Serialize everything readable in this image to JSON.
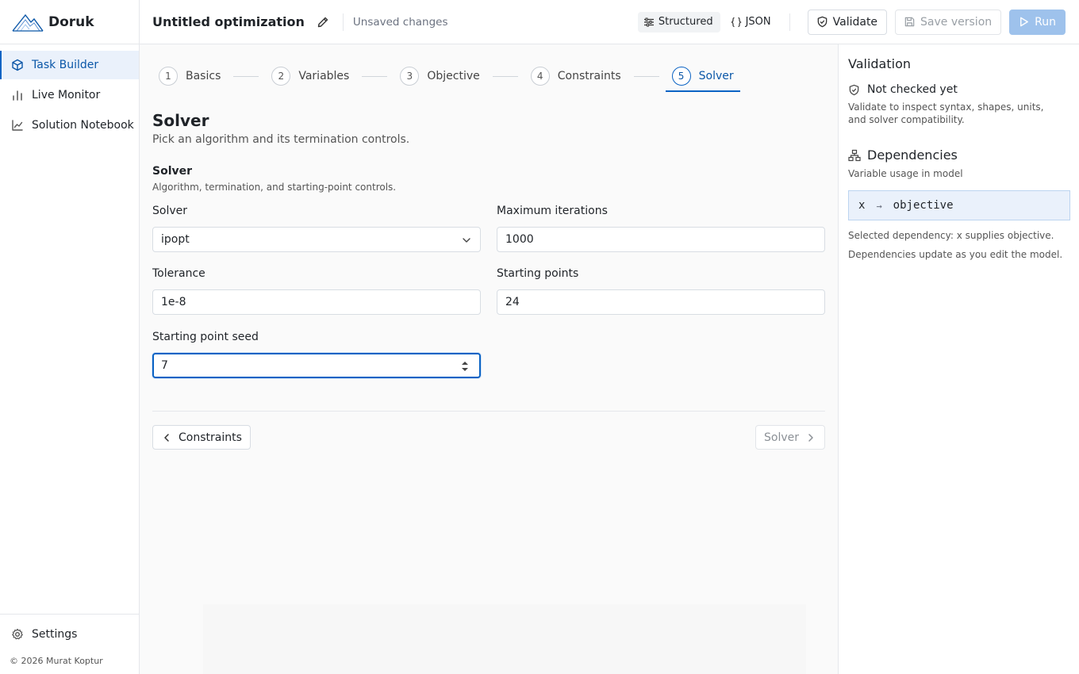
{
  "brand": {
    "name": "Doruk"
  },
  "sidebar": {
    "items": [
      {
        "label": "Task Builder",
        "active": true
      },
      {
        "label": "Live Monitor",
        "active": false
      },
      {
        "label": "Solution Notebook",
        "active": false
      }
    ],
    "settings_label": "Settings",
    "copyright": "© 2026 Murat Koptur"
  },
  "topbar": {
    "title": "Untitled optimization",
    "status": "Unsaved changes",
    "mode_structured": "Structured",
    "mode_json": "JSON",
    "validate_label": "Validate",
    "save_label": "Save version",
    "run_label": "Run"
  },
  "stepper": {
    "steps": [
      {
        "num": "1",
        "label": "Basics"
      },
      {
        "num": "2",
        "label": "Variables"
      },
      {
        "num": "3",
        "label": "Objective"
      },
      {
        "num": "4",
        "label": "Constraints"
      },
      {
        "num": "5",
        "label": "Solver"
      }
    ],
    "active_step": 5
  },
  "main": {
    "title": "Solver",
    "subtitle": "Pick an algorithm and its termination controls.",
    "group_title": "Solver",
    "group_subtitle": "Algorithm, termination, and starting-point controls.",
    "fields": {
      "solver": {
        "label": "Solver",
        "value": "ipopt"
      },
      "max_iterations": {
        "label": "Maximum iterations",
        "value": "1000"
      },
      "tolerance": {
        "label": "Tolerance",
        "value": "1e-8"
      },
      "starting_points": {
        "label": "Starting points",
        "value": "24"
      },
      "seed": {
        "label": "Starting point seed",
        "value": "7"
      }
    },
    "prev_label": "Constraints",
    "next_label": "Solver"
  },
  "validation": {
    "title": "Validation",
    "status": "Not checked yet",
    "hint": "Validate to inspect syntax, shapes, units, and solver compatibility."
  },
  "dependencies": {
    "title": "Dependencies",
    "subtitle": "Variable usage in model",
    "edge_from": "x",
    "edge_arrow": "→",
    "edge_to": "objective",
    "selected_text": "Selected dependency: x supplies objective.",
    "note": "Dependencies update as you edit the model."
  },
  "colors": {
    "accent": "#0b63c4",
    "accent_bg": "#eaf1fb",
    "run_button": "#9ec2ec"
  }
}
